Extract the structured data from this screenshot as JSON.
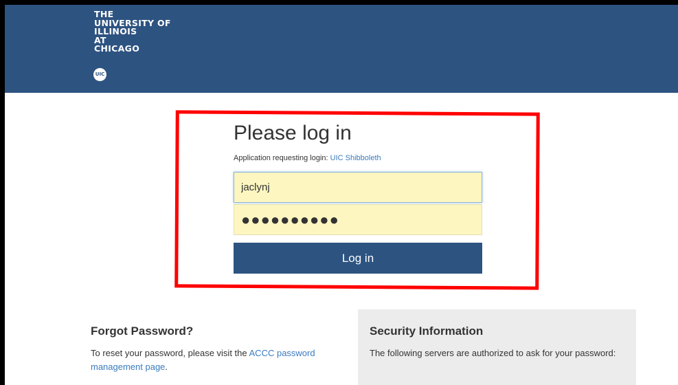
{
  "header": {
    "logo_lines": [
      "THE",
      "UNIVERSITY OF",
      "ILLINOIS",
      "AT",
      "CHICAGO"
    ],
    "logo_badge": "UIC",
    "background_color": "#2d5381"
  },
  "login": {
    "title": "Please log in",
    "app_label": "Application requesting login: ",
    "app_link": "UIC Shibboleth",
    "username_value": "jaclynj",
    "password_mask": "●●●●●●●●●●",
    "submit_label": "Log in",
    "highlight_color": "#ff0000"
  },
  "forgot": {
    "title": "Forgot Password?",
    "text_prefix": "To reset your password, please visit the ",
    "link": "ACCC password management page",
    "text_suffix": "."
  },
  "security": {
    "title": "Security Information",
    "text": "The following servers are authorized to ask for your password:"
  }
}
